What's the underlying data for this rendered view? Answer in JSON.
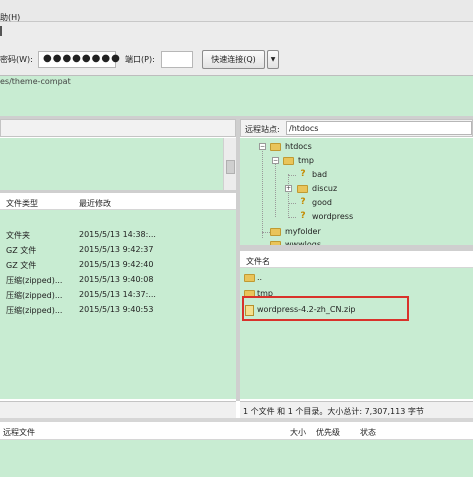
{
  "menubar": {
    "text": "助(H)"
  },
  "quickconnect": {
    "password_label": "密码(W):",
    "password_value": "●●●●●●●●",
    "port_label": "端口(P):",
    "port_value": "",
    "connect_button": "快速连接(Q)",
    "dropdown_glyph": "▼"
  },
  "log": {
    "line": "es/theme-compat"
  },
  "local": {
    "headers": {
      "type": "文件类型",
      "modified": "最近修改"
    },
    "files": [
      {
        "type": "文件夹",
        "modified": "2015/5/13 14:38:..."
      },
      {
        "type": "GZ 文件",
        "modified": "2015/5/13 9:42:37"
      },
      {
        "type": "GZ 文件",
        "modified": "2015/5/13 9:42:40"
      },
      {
        "type": "压缩(zipped)...",
        "modified": "2015/5/13 9:40:08"
      },
      {
        "type": "压缩(zipped)...",
        "modified": "2015/5/13 14:37:..."
      },
      {
        "type": "压缩(zipped)...",
        "modified": "2015/5/13 9:40:53"
      }
    ]
  },
  "remote": {
    "site_label": "远程站点:",
    "site_value": "/htdocs",
    "tree": {
      "htdocs": "htdocs",
      "tmp": "tmp",
      "bad": "bad",
      "discuz": "discuz",
      "good": "good",
      "wordpress": "wordpress",
      "myfolder": "myfolder",
      "wwwlogs": "wwwlogs"
    },
    "list_header": "文件名",
    "files": [
      "..",
      "tmp",
      "wordpress-4.2-zh_CN.zip"
    ],
    "status": "1 个文件 和 1 个目录。大小总计: 7,307,113 字节"
  },
  "queue": {
    "remote_file": "远程文件",
    "size": "大小",
    "priority": "优先级",
    "status": "状态"
  },
  "highlight_color": "#d9322b"
}
